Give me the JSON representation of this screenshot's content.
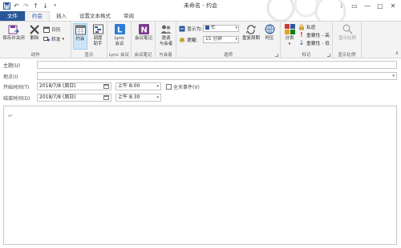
{
  "window": {
    "title": "未命名 - 约会"
  },
  "qat": {
    "items": [
      "save-icon",
      "undo-icon",
      "redo-icon",
      "up-icon",
      "down-icon",
      "customize-icon"
    ]
  },
  "window_controls": {
    "help": "?",
    "restore": "▭",
    "minimize": "—",
    "maximize": "□",
    "close": "✕"
  },
  "tabs": [
    {
      "label": "文件"
    },
    {
      "label": "约会"
    },
    {
      "label": "插入"
    },
    {
      "label": "设置文本格式"
    },
    {
      "label": "审阅"
    }
  ],
  "ribbon": {
    "groups": {
      "actions": {
        "label": "动作",
        "save_close": "保存并关闭",
        "delete": "删除",
        "calendar": "日历",
        "forward": "转发"
      },
      "show": {
        "label": "显示",
        "appointment": "约会",
        "scheduling_line1": "调度",
        "scheduling_line2": "助手"
      },
      "lync": {
        "label": "Lync 会议",
        "lync_line1": "Lync",
        "lync_line2": "会议"
      },
      "meeting_notes": {
        "label": "会议笔记",
        "btn": "会议笔记"
      },
      "attendees": {
        "label": "与会者",
        "invite_line1": "邀请",
        "invite_line2": "与会者"
      },
      "options": {
        "label": "选项",
        "show_as_label": "显示为:",
        "show_as_value": "忙",
        "reminder_label": "提醒:",
        "reminder_value": "15 分钟",
        "recurrence": "重复周期",
        "time_zones": "时区"
      },
      "tags": {
        "label": "标记",
        "categorize": "分类",
        "private": "私密",
        "high": "重要性 - 高",
        "low": "重要性 - 低"
      },
      "zoom": {
        "label": "显示比例",
        "btn": "显示比例"
      }
    }
  },
  "form": {
    "subject_label": "主题(U)",
    "subject_value": "",
    "location_label": "地点(I)",
    "location_value": "",
    "start_label": "开始时间(T)",
    "start_date": "2018/7/8 (周日)",
    "start_time": "上午 8:00",
    "allday_label": "全天事件(V)",
    "end_label": "结束时间(D)",
    "end_date": "2018/7/8 (周日)",
    "end_time": "上午 8:30",
    "body_mark": "↵"
  },
  "colors": {
    "file_tab": "#2b579a",
    "ribbon_bg": "#f3f3f3",
    "selected": "#cde6f7"
  }
}
